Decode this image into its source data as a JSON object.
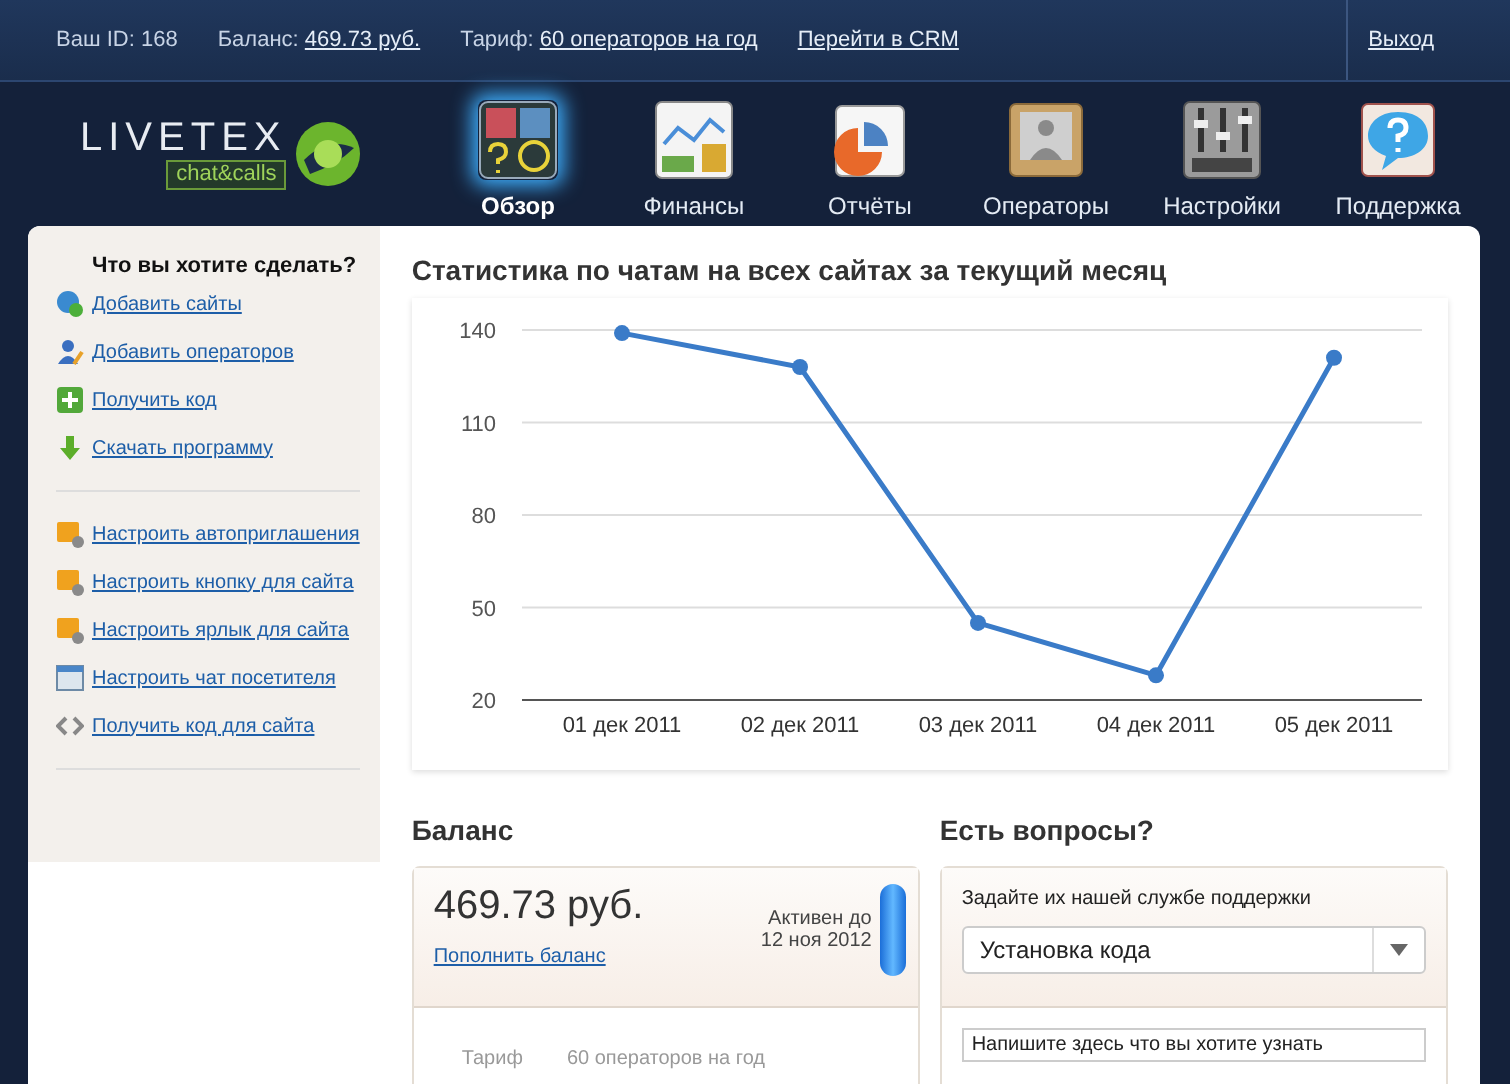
{
  "top_bar": {
    "id_label": "Ваш ID:",
    "id_value": "168",
    "balance_label": "Баланс:",
    "balance_link": "469.73 руб.",
    "tariff_label": "Тариф:",
    "tariff_link": "60 операторов на год",
    "crm_link": "Перейти в CRM",
    "logout": "Выход"
  },
  "logo": {
    "wordmark": "LIVETEX",
    "tagline": "chat&calls"
  },
  "nav": [
    {
      "label": "Обзор",
      "kind": "overview",
      "selected": true
    },
    {
      "label": "Финансы",
      "kind": "finance",
      "selected": false
    },
    {
      "label": "Отчёты",
      "kind": "reports",
      "selected": false
    },
    {
      "label": "Операторы",
      "kind": "operators",
      "selected": false
    },
    {
      "label": "Настройки",
      "kind": "settings",
      "selected": false
    },
    {
      "label": "Поддержка",
      "kind": "support",
      "selected": false
    }
  ],
  "sidebar": {
    "title": "Что вы хотите сделать?",
    "groups": [
      [
        {
          "label": "Добавить сайты",
          "kind": "globe"
        },
        {
          "label": "Добавить операторов",
          "kind": "person"
        },
        {
          "label": "Получить код",
          "kind": "plus"
        },
        {
          "label": "Скачать программу",
          "kind": "download"
        }
      ],
      [
        {
          "label": "Настроить автоприглашения",
          "kind": "card"
        },
        {
          "label": "Настроить кнопку для сайта",
          "kind": "card"
        },
        {
          "label": "Настроить ярлык для сайта",
          "kind": "card"
        },
        {
          "label": "Настроить чат посетителя",
          "kind": "window"
        },
        {
          "label": "Получить код для сайта",
          "kind": "code"
        }
      ]
    ]
  },
  "stats": {
    "title": "Статистика по чатам на всех сайтах за текущий месяц",
    "chart_data": {
      "type": "line",
      "categories": [
        "01 дек 2011",
        "02 дек 2011",
        "03 дек 2011",
        "04 дек 2011",
        "05 дек 2011"
      ],
      "series": [
        {
          "color": "#3a7bc8",
          "marker": true,
          "values": [
            139,
            128,
            45,
            28,
            131
          ]
        }
      ],
      "grid": true,
      "ylim": [
        20,
        140
      ],
      "yticks": [
        20,
        50,
        80,
        110,
        140
      ]
    }
  },
  "balance": {
    "title": "Баланс",
    "amount": "469.73 руб.",
    "topup_link": "Пополнить баланс",
    "active_label": "Активен до",
    "active_date": "12 ноя 2012",
    "tariff_label": "Тариф",
    "tariff_value": "60 операторов на год"
  },
  "support": {
    "title": "Есть вопросы?",
    "prompt": "Задайте их нашей службе поддержки",
    "topic": "Установка кода",
    "message_placeholder": "Напишите здесь что вы хотите узнать"
  }
}
